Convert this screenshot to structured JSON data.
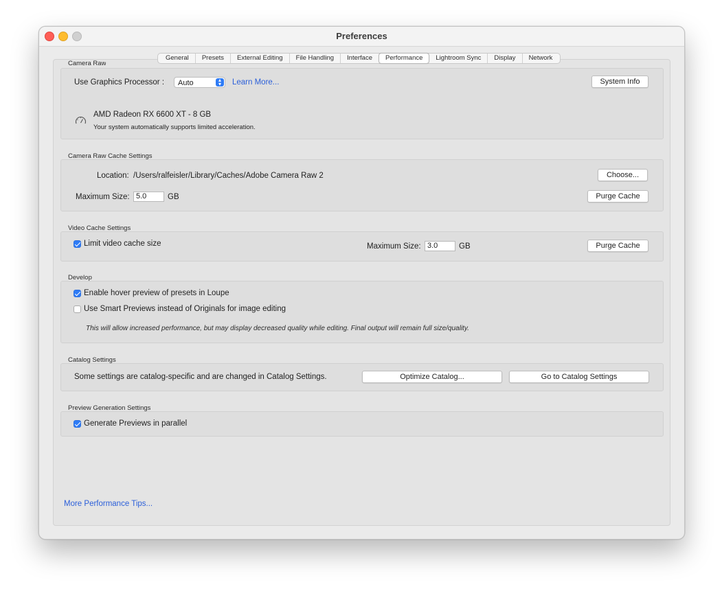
{
  "window": {
    "title": "Preferences"
  },
  "tabs": [
    {
      "label": "General",
      "active": false
    },
    {
      "label": "Presets",
      "active": false
    },
    {
      "label": "External Editing",
      "active": false
    },
    {
      "label": "File Handling",
      "active": false
    },
    {
      "label": "Interface",
      "active": false
    },
    {
      "label": "Performance",
      "active": true
    },
    {
      "label": "Lightroom Sync",
      "active": false
    },
    {
      "label": "Display",
      "active": false
    },
    {
      "label": "Network",
      "active": false
    }
  ],
  "camera_raw": {
    "section_label": "Camera Raw",
    "gpu_label": "Use Graphics Processor :",
    "gpu_value": "Auto",
    "learn_more": "Learn More...",
    "system_info": "System Info",
    "gpu_name": "AMD Radeon RX 6600 XT - 8 GB",
    "gpu_status": "Your system automatically supports limited acceleration."
  },
  "cache": {
    "section_label": "Camera Raw Cache Settings",
    "location_label": "Location:",
    "location_value": "/Users/ralfeisler/Library/Caches/Adobe Camera Raw 2",
    "choose": "Choose...",
    "max_size_label": "Maximum Size:",
    "max_size_value": "5.0",
    "unit": "GB",
    "purge": "Purge Cache"
  },
  "video": {
    "section_label": "Video Cache Settings",
    "limit_label": "Limit video cache size",
    "limit_checked": true,
    "max_size_label": "Maximum Size:",
    "max_size_value": "3.0",
    "unit": "GB",
    "purge": "Purge Cache"
  },
  "develop": {
    "section_label": "Develop",
    "hover_label": "Enable hover preview of presets in Loupe",
    "hover_checked": true,
    "smart_label": "Use Smart Previews instead of Originals for image editing",
    "smart_checked": false,
    "note": "This will allow increased performance, but may display decreased quality while editing. Final output will remain full size/quality."
  },
  "catalog": {
    "section_label": "Catalog Settings",
    "text": "Some settings are catalog-specific and are changed in Catalog Settings.",
    "optimize": "Optimize Catalog...",
    "goto": "Go to Catalog Settings"
  },
  "preview": {
    "section_label": "Preview Generation Settings",
    "parallel_label": "Generate Previews in parallel",
    "parallel_checked": true
  },
  "footer": {
    "tips": "More Performance Tips..."
  },
  "colors": {
    "accent": "#2f7cf6",
    "link": "#2b5fd9"
  },
  "icons": {
    "gpu": "speedometer-icon",
    "select": "chevron-updown-icon",
    "check": "checkmark-icon"
  }
}
